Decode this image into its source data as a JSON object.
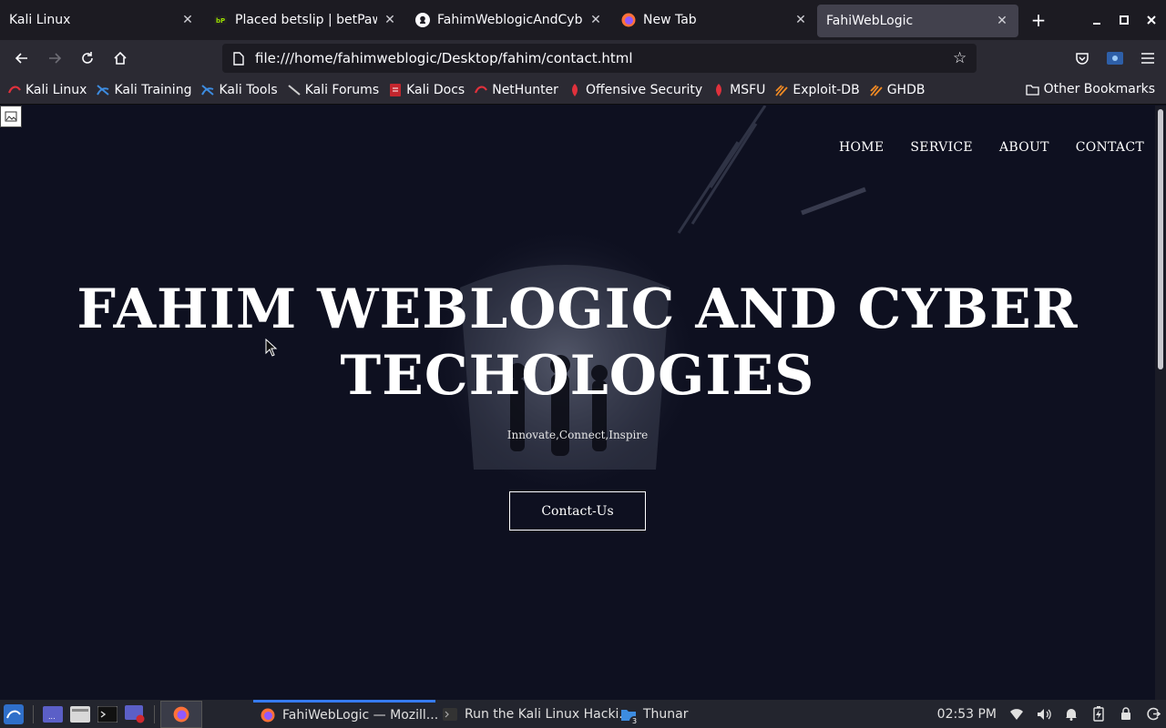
{
  "browser": {
    "tabs": [
      {
        "title": "Kali Linux",
        "icon": "kali-icon",
        "active": false
      },
      {
        "title": "Placed betslip | betPawa U",
        "icon": "betpawa-icon",
        "active": false
      },
      {
        "title": "FahimWeblogicAndCyber",
        "icon": "github-icon",
        "active": false
      },
      {
        "title": "New Tab",
        "icon": "firefox-icon",
        "active": false
      },
      {
        "title": "FahiWebLogic",
        "icon": "",
        "active": true
      }
    ],
    "url": "file:///home/fahimweblogic/Desktop/fahim/contact.html",
    "bookmarks": [
      {
        "label": "Kali Linux",
        "icon": "kali-icon"
      },
      {
        "label": "Kali Training",
        "icon": "kali-training-icon"
      },
      {
        "label": "Kali Tools",
        "icon": "kali-tools-icon"
      },
      {
        "label": "Kali Forums",
        "icon": "kali-forums-icon"
      },
      {
        "label": "Kali Docs",
        "icon": "kali-docs-icon"
      },
      {
        "label": "NetHunter",
        "icon": "nethunter-icon"
      },
      {
        "label": "Offensive Security",
        "icon": "offsec-icon"
      },
      {
        "label": "MSFU",
        "icon": "msfu-icon"
      },
      {
        "label": "Exploit-DB",
        "icon": "exploitdb-icon"
      },
      {
        "label": "GHDB",
        "icon": "ghdb-icon"
      }
    ],
    "other_bookmarks": "Other Bookmarks"
  },
  "site": {
    "nav": [
      "HOME",
      "SERVICE",
      "ABOUT",
      "CONTACT"
    ],
    "title_line1": "FAHIM WEBLOGIC AND CYBER",
    "title_line2": "TECHOLOGIES",
    "tagline": "Innovate,Connect,Inspire",
    "cta": "Contact-Us"
  },
  "taskbar": {
    "windows": [
      {
        "title": "FahiWebLogic — Mozill...",
        "icon": "firefox-icon",
        "active": true
      },
      {
        "title": "Run the Kali Linux Hacki...",
        "icon": "terminal-icon",
        "active": false
      },
      {
        "title": "Thunar",
        "icon": "folder-icon",
        "active": false,
        "badge": "3"
      }
    ],
    "clock": "02:53 PM"
  },
  "colors": {
    "page_bg": "#0e1020",
    "tab_strip": "#1c1b22",
    "toolbar": "#2b2a33",
    "active_tab": "#42414d",
    "taskbar": "#23252e",
    "accent": "#367bf0"
  }
}
